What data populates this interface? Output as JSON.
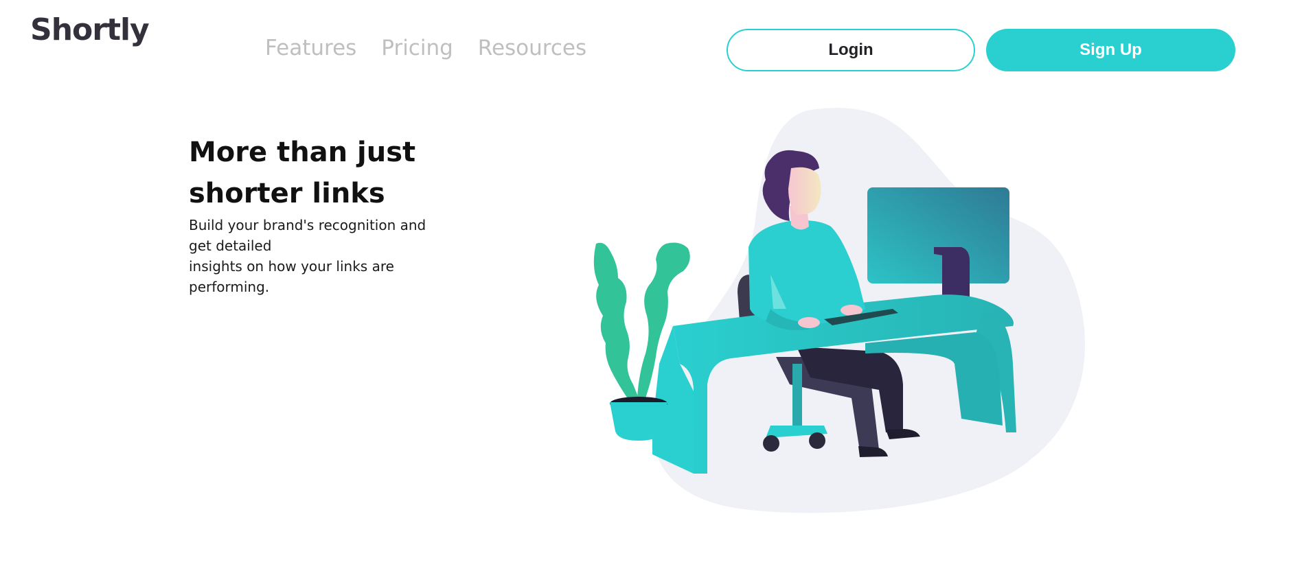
{
  "header": {
    "logo": "Shortly",
    "nav": [
      "Features",
      "Pricing",
      "Resources"
    ],
    "login_label": "Login",
    "signup_label": "Sign Up"
  },
  "hero": {
    "title_line1": "More than just",
    "title_line2": "shorter links",
    "subtitle_lines": [
      "Build your brand's recognition and",
      "get detailed",
      "insights on how your links are",
      "performing."
    ]
  },
  "colors": {
    "accent": "#2acfcf",
    "logo": "#34313d",
    "nav_text": "#bfbfbf",
    "blob": "#f0f1f6",
    "plant": "#33c398",
    "hair": "#4b2f6b"
  },
  "illustration": {
    "icon": "person-working-at-desk-illustration"
  }
}
